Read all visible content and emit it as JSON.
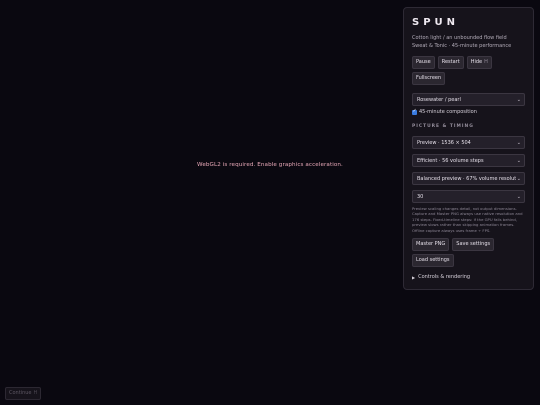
{
  "stage": {
    "message": "WebGL2 is required. Enable graphics acceleration."
  },
  "panel": {
    "title": "SPUN",
    "subtitle_line1": "Cotton light / an unbounded flow field",
    "subtitle_line2": "Sweat & Tonic · 45-minute performance",
    "buttons": {
      "pause": "Pause",
      "restart": "Restart",
      "hide": "Hide",
      "hide_key": "H",
      "fullscreen": "Fullscreen"
    },
    "palette_select": "Rosewater / pearl",
    "composition_checkbox": {
      "label": "45-minute composition",
      "checked": true
    },
    "picture_timing_heading": "PICTURE & TIMING",
    "preview_select": "Preview · 1536 × 504",
    "quality_select": "Efficient · 56 volume steps",
    "balance_select": "Balanced preview · 67% volume resoluti",
    "fps_select": "30",
    "note": "Preview scaling changes detail, not output dimensions. Capture and Master PNG always use native resolution and 176 steps. Fixed-timeline steps: if the GPU falls behind, preview slows rather than skipping animation frames. Offline capture always uses frame ÷ FPS.",
    "export_buttons": {
      "master_png": "Master PNG",
      "save_settings": "Save settings",
      "load_settings": "Load settings"
    },
    "details_label": "Controls & rendering",
    "details_marker": "▶"
  },
  "continue_button": {
    "label": "Continue",
    "key": "H"
  },
  "colors": {
    "background": "#0a0810",
    "panel": "#16131b",
    "message": "#e8a8b8",
    "accent": "#3a7be0"
  }
}
